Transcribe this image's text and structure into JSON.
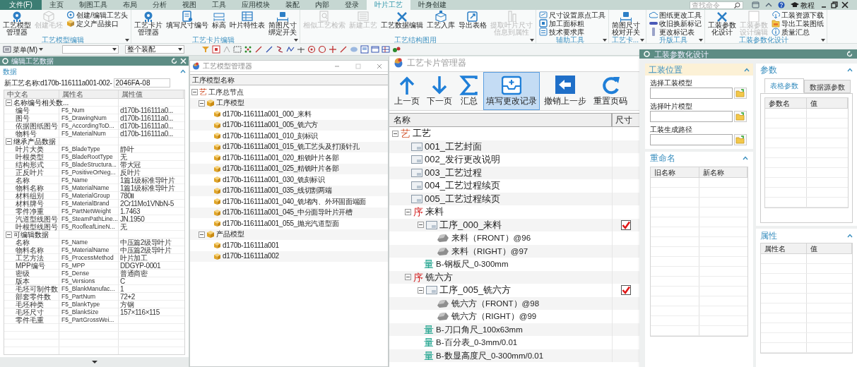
{
  "menu_tabs": [
    {
      "label": "文件(F)",
      "kind": "file",
      "selected": false
    },
    {
      "label": "主页",
      "kind": "tab",
      "selected": false
    },
    {
      "label": "制图工具",
      "kind": "tab",
      "selected": false
    },
    {
      "label": "布局",
      "kind": "tab",
      "selected": false
    },
    {
      "label": "分析",
      "kind": "tab",
      "selected": false
    },
    {
      "label": "视图",
      "kind": "tab",
      "selected": false
    },
    {
      "label": "工具",
      "kind": "tab",
      "selected": false
    },
    {
      "label": "应用模块",
      "kind": "tab",
      "selected": false
    },
    {
      "label": "装配",
      "kind": "tab",
      "selected": false
    },
    {
      "label": "内部",
      "kind": "tab",
      "selected": false
    },
    {
      "label": "登录",
      "kind": "tab",
      "selected": false
    },
    {
      "label": "叶片工艺",
      "kind": "tab",
      "selected": true
    },
    {
      "label": "叶身创建",
      "kind": "tab",
      "selected": false
    }
  ],
  "search": {
    "placeholder": "查找命令"
  },
  "help_label": "教程",
  "ribbon_groups": [
    {
      "label": "工艺模型编辑",
      "items": [
        {
          "kind": "large",
          "lines": [
            "工艺模型",
            "管理器"
          ],
          "disabled": false
        },
        {
          "kind": "large",
          "lines": [
            "创建毛坯"
          ],
          "disabled": true
        },
        {
          "kind": "stack",
          "entries": [
            {
              "label": "创建/编辑工艺头",
              "disabled": false
            },
            {
              "label": "定义产品接口",
              "disabled": false
            }
          ]
        }
      ]
    },
    {
      "label": "工艺卡片编辑",
      "items": [
        {
          "kind": "large",
          "lines": [
            "工艺卡片",
            "管理器"
          ],
          "disabled": false
        },
        {
          "kind": "large",
          "lines": [
            "填写尺寸编号"
          ],
          "disabled": false
        },
        {
          "kind": "large",
          "lines": [
            "标高"
          ],
          "disabled": false
        },
        {
          "kind": "large",
          "lines": [
            "叶片特性表"
          ],
          "disabled": false
        },
        {
          "kind": "large",
          "lines": [
            "简图尺寸",
            "绑定开关"
          ],
          "disabled": false
        }
      ]
    },
    {
      "label": "工艺结构图用",
      "items": [
        {
          "kind": "large",
          "lines": [
            "相似工艺检索"
          ],
          "disabled": true
        },
        {
          "kind": "large",
          "lines": [
            "新建工艺"
          ],
          "disabled": true
        },
        {
          "kind": "large",
          "lines": [
            "工艺数据编辑"
          ],
          "disabled": false
        },
        {
          "kind": "large",
          "lines": [
            "工艺入库"
          ],
          "disabled": false
        },
        {
          "kind": "large",
          "lines": [
            "导出表格"
          ],
          "disabled": false
        },
        {
          "kind": "large",
          "lines": [
            "提取叶片尺寸",
            "信息到属性"
          ],
          "disabled": true
        }
      ]
    },
    {
      "label": "辅助工具",
      "items": [
        {
          "kind": "stack",
          "entries": [
            {
              "label": "尺寸设置原点工具",
              "disabled": false
            },
            {
              "label": "加工面标粗",
              "disabled": false
            },
            {
              "label": "技术要求库",
              "disabled": false
            }
          ]
        }
      ]
    },
    {
      "label": "工艺卡...",
      "items": [
        {
          "kind": "large",
          "lines": [
            "简图尺寸",
            "校对开关"
          ],
          "disabled": false
        }
      ]
    },
    {
      "label": "升版工具",
      "items": [
        {
          "kind": "stack",
          "entries": [
            {
              "label": "图纸更改工具",
              "disabled": false
            },
            {
              "label": "收旧换新标记",
              "disabled": false
            },
            {
              "label": "更改标记表",
              "disabled": false
            }
          ]
        }
      ]
    },
    {
      "label": "工装参数化设计",
      "items": [
        {
          "kind": "large",
          "lines": [
            "工装参数",
            "化设计"
          ],
          "disabled": false
        },
        {
          "kind": "large",
          "lines": [
            "工装参数",
            "设计编辑"
          ],
          "disabled": true
        },
        {
          "kind": "stack",
          "entries": [
            {
              "label": "工装资源下载",
              "disabled": false
            },
            {
              "label": "导出工装图纸",
              "disabled": false
            },
            {
              "label": "质量汇总",
              "disabled": false
            }
          ]
        }
      ]
    }
  ],
  "toolbar": {
    "menu_label": "菜单(M)",
    "assembly_filter": "整个装配"
  },
  "edit_panel": {
    "title": "编辑工艺数据",
    "section": "数据",
    "name_label": "新工艺名称:d170b-116111a001-002-",
    "name_value": "2046FA-08",
    "columns": [
      "中文名",
      "属性名",
      "属性值"
    ],
    "groups": [
      {
        "label": "名称编号相关数...",
        "expanded": true,
        "rows": [
          {
            "cn": "编号",
            "attr": "F5_Num",
            "value": "d170b-116111a0..."
          },
          {
            "cn": "图号",
            "attr": "F5_DrawingNum",
            "value": "d170b-116111a0..."
          },
          {
            "cn": "依据图纸图号",
            "attr": "F5_AccordingToD...",
            "value": "d170b-116111a0..."
          },
          {
            "cn": "物料号",
            "attr": "F5_MaterialNum",
            "value": "d170b-116111a0..."
          }
        ]
      },
      {
        "label": "继承产品数据",
        "expanded": true,
        "rows": [
          {
            "cn": "叶片大类",
            "attr": "F5_BladeType",
            "value": "静叶"
          },
          {
            "cn": "叶根类型",
            "attr": "F5_BladeRootType",
            "value": "无"
          },
          {
            "cn": "结构形式",
            "attr": "F5_BladeStructura...",
            "value": "带大冠"
          },
          {
            "cn": "正反叶片",
            "attr": "F5_PositiveOrNeg...",
            "value": "反叶片"
          },
          {
            "cn": "名称",
            "attr": "F5_Name",
            "value": "1篇1级标准导叶片"
          },
          {
            "cn": "物料名称",
            "attr": "F5_MaterialName",
            "value": "1篇1级标准导叶片"
          },
          {
            "cn": "材料组别",
            "attr": "F5_MaterialGroup",
            "value": "780Ⅱ"
          },
          {
            "cn": "材料牌号",
            "attr": "F5_MaterialBrand",
            "value": "2Cr11Mo1VNbN-5"
          },
          {
            "cn": "零件净重",
            "attr": "F5_PartNetWeight",
            "value": "1.7463"
          },
          {
            "cn": "汽道型线图号",
            "attr": "F5_SteamPathLine...",
            "value": "JN.1950"
          },
          {
            "cn": "叶根型线图号",
            "attr": "F5_RoofleafLineN...",
            "value": "无"
          }
        ]
      },
      {
        "label": "可编辑数据",
        "expanded": true,
        "rows": [
          {
            "cn": "名称",
            "attr": "F5_Name",
            "value": "中压篇2级导叶片"
          },
          {
            "cn": "物料名称",
            "attr": "F5_MaterialName",
            "value": "中压篇2级导叶片"
          },
          {
            "cn": "工艺方法",
            "attr": "F5_ProcessMethod",
            "value": "叶片加工"
          },
          {
            "cn": "MPP编号",
            "attr": "F5_MPP",
            "value": "DDGYP-0001"
          },
          {
            "cn": "密级",
            "attr": "F5_Dense",
            "value": "普通商密"
          },
          {
            "cn": "版本",
            "attr": "F5_Versions",
            "value": "C"
          },
          {
            "cn": "毛坯可制件数",
            "attr": "F5_BlankManufac...",
            "value": "1"
          },
          {
            "cn": "部套零件数",
            "attr": "F5_PartNum",
            "value": "72+2"
          },
          {
            "cn": "毛坯种类",
            "attr": "F5_BlankType",
            "value": "方钢"
          },
          {
            "cn": "毛坯尺寸",
            "attr": "F5_BlankSize",
            "value": "157×116×115"
          },
          {
            "cn": "零件毛重",
            "attr": "F5_PartGrossWei..."
          }
        ]
      }
    ]
  },
  "model_manager": {
    "title": "工艺模型管理器",
    "column": "工序模型名称",
    "tree": [
      {
        "kind": "root",
        "mark": "艺",
        "label": "工序总节点",
        "expanded": true,
        "children": [
          {
            "kind": "folder",
            "label": "工序模型",
            "expanded": true,
            "children": [
              {
                "kind": "model",
                "label": "d170b-116111a001_000_来料"
              },
              {
                "kind": "model",
                "label": "d170b-116111a001_005_铣六方"
              },
              {
                "kind": "model",
                "label": "d170b-116111a001_010_刻标识"
              },
              {
                "kind": "model",
                "label": "d170b-116111a001_015_铣工艺头及打顶针孔"
              },
              {
                "kind": "model",
                "label": "d170b-116111a001_020_粗铣叶片各部"
              },
              {
                "kind": "model",
                "label": "d170b-116111a001_025_精铣叶片各部"
              },
              {
                "kind": "model",
                "label": "d170b-116111a001_030_铣刻标识"
              },
              {
                "kind": "model",
                "label": "d170b-116111a001_035_线切割两端"
              },
              {
                "kind": "model",
                "label": "d170b-116111a001_040_铣堵内、外环固面端面"
              },
              {
                "kind": "model",
                "label": "d170b-116111a001_045_中分面导叶片开槽"
              },
              {
                "kind": "model",
                "label": "d170b-116111a001_055_抛光汽道型面"
              }
            ]
          },
          {
            "kind": "folder",
            "label": "产品模型",
            "expanded": true,
            "children": [
              {
                "kind": "model",
                "label": "d170b-116111a001"
              },
              {
                "kind": "model",
                "label": "d170b-116111a002"
              }
            ]
          }
        ]
      }
    ]
  },
  "card_manager": {
    "title": "工艺卡片管理器",
    "tools": [
      {
        "kind": "up",
        "label": "上一页",
        "selected": false
      },
      {
        "kind": "down",
        "label": "下一页",
        "selected": false
      },
      {
        "kind": "sum",
        "label": "汇总",
        "selected": false
      },
      {
        "kind": "record",
        "label": "填写更改记录",
        "selected": true
      },
      {
        "kind": "undo",
        "label": "撤销上一步",
        "selected": false
      },
      {
        "kind": "reset",
        "label": "重置页码",
        "selected": false
      }
    ],
    "columns": [
      "名称",
      "尺寸"
    ],
    "tree": [
      {
        "kind": "craft",
        "mark": "艺",
        "label": "工艺",
        "expanded": true,
        "children": [
          {
            "kind": "page",
            "label": "001_工艺封面"
          },
          {
            "kind": "page",
            "label": "002_发行更改说明"
          },
          {
            "kind": "page",
            "label": "003_工艺过程"
          },
          {
            "kind": "page",
            "label": "004_工艺过程续页"
          },
          {
            "kind": "page",
            "label": "005_工艺过程续页"
          },
          {
            "kind": "process",
            "mark": "序",
            "label": "来料",
            "expanded": true,
            "children": [
              {
                "kind": "step",
                "label": "工序_000_来料",
                "checked": true,
                "expanded": true,
                "children": [
                  {
                    "kind": "view",
                    "label": "来料（FRONT）@96"
                  },
                  {
                    "kind": "view",
                    "label": "来料（RIGHT）@97"
                  }
                ]
              },
              {
                "kind": "gauge",
                "mark": "量",
                "label": "B-钢板尺_0-300mm"
              }
            ]
          },
          {
            "kind": "process",
            "mark": "序",
            "label": "铣六方",
            "expanded": true,
            "children": [
              {
                "kind": "step",
                "label": "工序_005_铣六方",
                "checked": true,
                "expanded": true,
                "children": [
                  {
                    "kind": "view",
                    "label": "铣六方（FRONT）@98"
                  },
                  {
                    "kind": "view",
                    "label": "铣六方（RIGHT）@99"
                  }
                ]
              },
              {
                "kind": "gauge",
                "mark": "量",
                "label": "B-刀口角尺_100x63mm"
              },
              {
                "kind": "gauge",
                "mark": "量",
                "label": "B-百分表_0-3mm/0.01"
              },
              {
                "kind": "gauge",
                "mark": "量",
                "label": "B-数显高度尺_0-300mm/0.01"
              }
            ]
          }
        ]
      }
    ]
  },
  "tooling_panel": {
    "title": "工装参数化设计",
    "position": {
      "title": "工装位置",
      "fields": [
        {
          "label": "选择工装模型"
        },
        {
          "label": "选择叶片模型"
        },
        {
          "label": "工装生成路径"
        }
      ]
    },
    "rename": {
      "title": "重命名",
      "columns": [
        "旧名称",
        "新名称"
      ]
    },
    "params": {
      "title": "参数",
      "tabs": [
        {
          "label": "表格参数",
          "selected": true
        },
        {
          "label": "数据源参数",
          "selected": false
        }
      ],
      "columns": [
        "参数名",
        "值"
      ]
    },
    "properties": {
      "title": "属性",
      "columns": [
        "属性名",
        "值"
      ]
    }
  }
}
